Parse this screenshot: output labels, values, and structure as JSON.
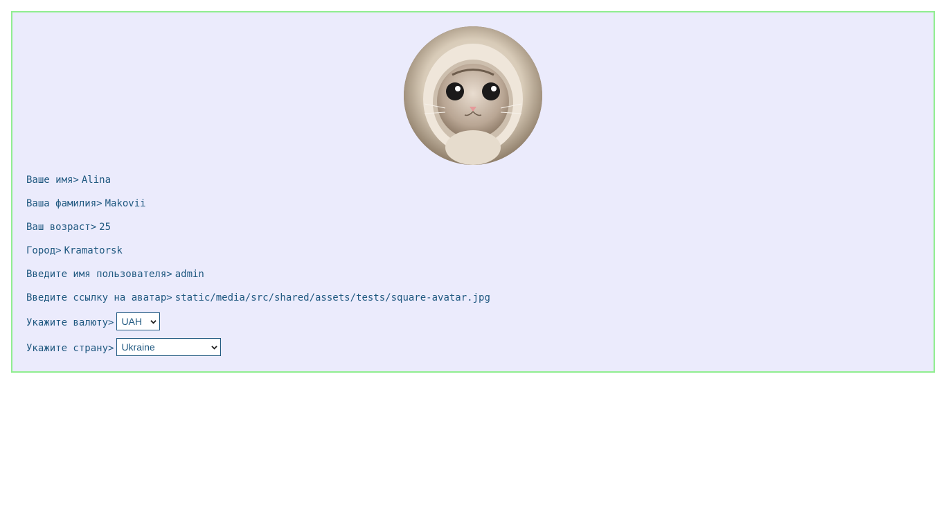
{
  "profile": {
    "avatar_alt": "avatar",
    "fields": [
      {
        "label": "Ваше имя>",
        "value": "Alina"
      },
      {
        "label": "Ваша фамилия>",
        "value": "Makovii"
      },
      {
        "label": "Ваш возраст>",
        "value": "25"
      },
      {
        "label": "Город>",
        "value": "Kramatorsk"
      },
      {
        "label": "Введите имя пользователя>",
        "value": "admin"
      },
      {
        "label": "Введите ссылку на аватар>",
        "value": "static/media/src/shared/assets/tests/square-avatar.jpg"
      }
    ],
    "currency": {
      "label": "Укажите валюту>",
      "selected": "UAH"
    },
    "country": {
      "label": "Укажите страну>",
      "selected": "Ukraine"
    }
  },
  "colors": {
    "panel_background": "#ebebfc",
    "panel_border": "#90ee90",
    "text": "#1f5880"
  },
  "icons": {
    "dropdown": "chevron-down-icon",
    "avatar": "cat-avatar-image"
  }
}
